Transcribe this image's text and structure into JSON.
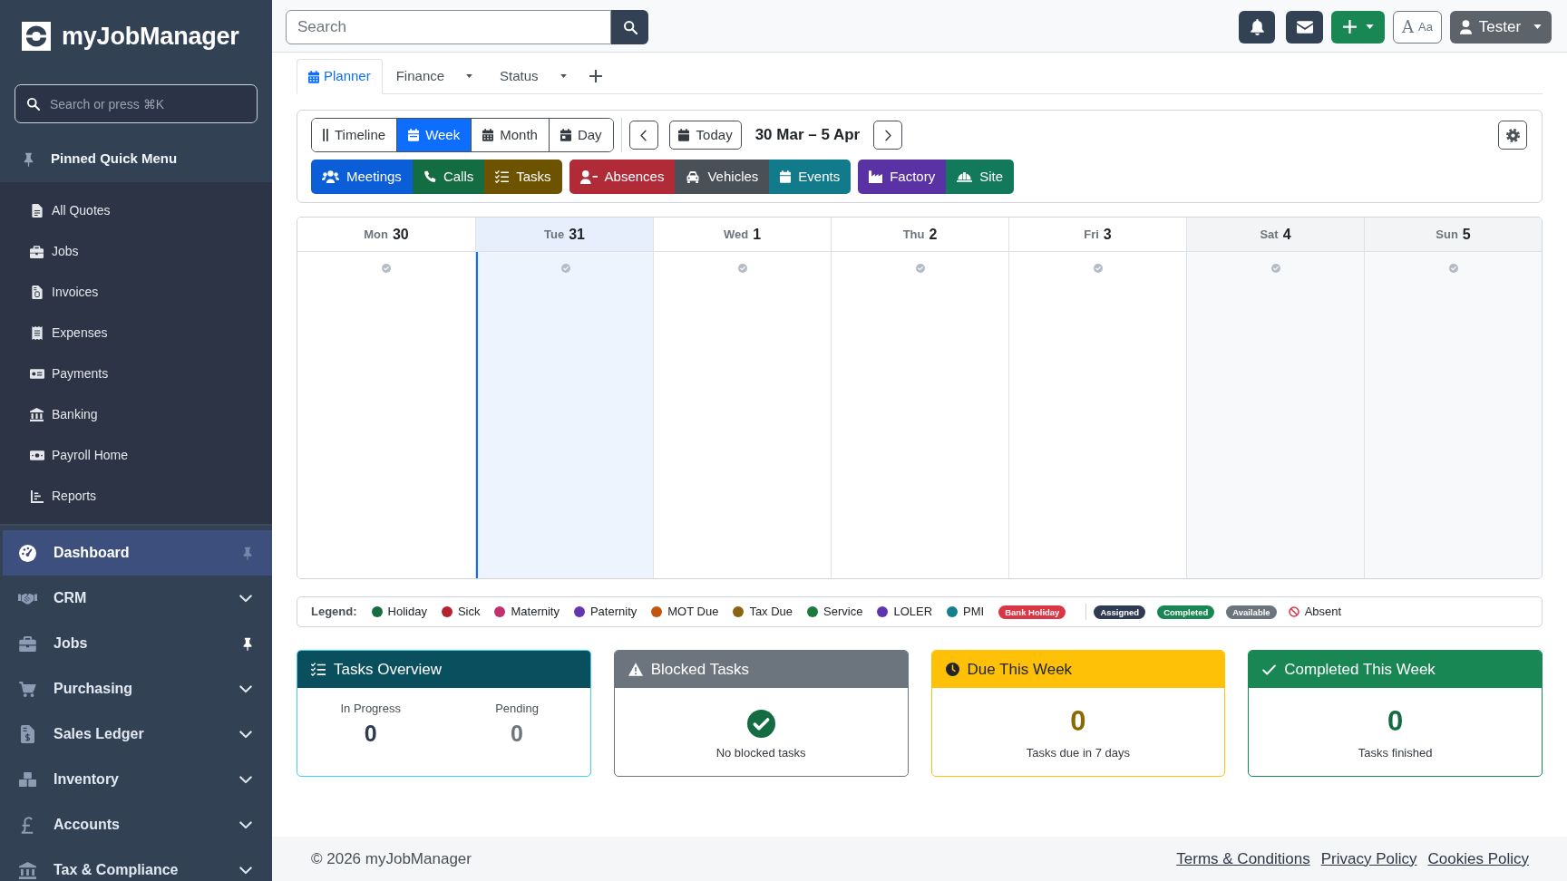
{
  "sidebar": {
    "brand": "myJobManager",
    "search": {
      "placeholder": "Search or press ⌘K"
    },
    "pinned_menu": {
      "title": "Pinned Quick Menu",
      "items": [
        "All Quotes",
        "Jobs",
        "Invoices",
        "Expenses",
        "Payments",
        "Banking",
        "Payroll Home",
        "Reports"
      ]
    },
    "nav": [
      {
        "label": "Dashboard",
        "kind": "link",
        "selected": true,
        "pinned": false
      },
      {
        "label": "CRM",
        "kind": "group",
        "selected": false,
        "expanded": false
      },
      {
        "label": "Jobs",
        "kind": "link",
        "selected": false,
        "pinned": true
      },
      {
        "label": "Purchasing",
        "kind": "group",
        "selected": false,
        "expanded": false
      },
      {
        "label": "Sales Ledger",
        "kind": "group",
        "selected": false,
        "expanded": false
      },
      {
        "label": "Inventory",
        "kind": "group",
        "selected": false,
        "expanded": false
      },
      {
        "label": "Accounts",
        "kind": "group",
        "selected": false,
        "expanded": false
      },
      {
        "label": "Tax & Compliance",
        "kind": "group",
        "selected": false,
        "expanded": false
      }
    ]
  },
  "topbar": {
    "search": {
      "placeholder": "Search"
    },
    "text_size_button": {
      "glyph": "A",
      "label": "Aa"
    },
    "user_menu": {
      "label": "Tester"
    }
  },
  "tabs": [
    {
      "label": "Planner",
      "selected": true,
      "has_menu": false
    },
    {
      "label": "Finance",
      "selected": false,
      "has_menu": true
    },
    {
      "label": "Status",
      "selected": false,
      "has_menu": true
    }
  ],
  "toolbar": {
    "view_modes": [
      {
        "label": "Timeline",
        "selected": false
      },
      {
        "label": "Week",
        "selected": true
      },
      {
        "label": "Month",
        "selected": false
      },
      {
        "label": "Day",
        "selected": false
      }
    ],
    "today_button": "Today",
    "date_range": "30 Mar – 5 Apr",
    "category_groups": [
      [
        {
          "label": "Meetings",
          "color": "#0b5ed7"
        },
        {
          "label": "Calls",
          "color": "#146c43"
        },
        {
          "label": "Tasks",
          "color": "#6d5200"
        }
      ],
      [
        {
          "label": "Absences",
          "color": "#b02a37"
        },
        {
          "label": "Vehicles",
          "color": "#495057"
        },
        {
          "label": "Events",
          "color": "#117a8b"
        }
      ],
      [
        {
          "label": "Factory",
          "color": "#5a32a3"
        },
        {
          "label": "Site",
          "color": "#13795b"
        }
      ]
    ]
  },
  "calendar": {
    "days": [
      {
        "weekday": "Mon",
        "date": "30",
        "today": false,
        "weekend": false
      },
      {
        "weekday": "Tue",
        "date": "31",
        "today": true,
        "weekend": false
      },
      {
        "weekday": "Wed",
        "date": "1",
        "today": false,
        "weekend": false
      },
      {
        "weekday": "Thu",
        "date": "2",
        "today": false,
        "weekend": false
      },
      {
        "weekday": "Fri",
        "date": "3",
        "today": false,
        "weekend": false
      },
      {
        "weekday": "Sat",
        "date": "4",
        "today": false,
        "weekend": true
      },
      {
        "weekday": "Sun",
        "date": "5",
        "today": false,
        "weekend": true
      }
    ]
  },
  "legend": {
    "title": "Legend:",
    "items": [
      {
        "kind": "dot",
        "label": "Holiday",
        "color": "#1a6b40"
      },
      {
        "kind": "dot",
        "label": "Sick",
        "color": "#b32430"
      },
      {
        "kind": "dot",
        "label": "Maternity",
        "color": "#c2306e"
      },
      {
        "kind": "dot",
        "label": "Paternity",
        "color": "#6236b0"
      },
      {
        "kind": "dot",
        "label": "MOT Due",
        "color": "#c2560f"
      },
      {
        "kind": "dot",
        "label": "Tax Due",
        "color": "#8a6212"
      },
      {
        "kind": "dot",
        "label": "Service",
        "color": "#1d7a3e"
      },
      {
        "kind": "dot",
        "label": "LOLER",
        "color": "#5e35b1"
      },
      {
        "kind": "dot",
        "label": "PMI",
        "color": "#157f8e"
      },
      {
        "kind": "badge",
        "label": "Bank Holiday",
        "color": "#dc3545"
      }
    ],
    "statuses": [
      {
        "kind": "badge",
        "label": "Assigned",
        "color": "#2f3b52"
      },
      {
        "kind": "badge",
        "label": "Completed",
        "color": "#198754"
      },
      {
        "kind": "badge",
        "label": "Available",
        "color": "#6c757d"
      },
      {
        "kind": "ban",
        "label": "Absent"
      }
    ]
  },
  "cards": [
    {
      "kind": "stats",
      "title": "Tasks Overview",
      "color": "#0a4f5e",
      "border": {
        "color": "#3cd3f0"
      },
      "stats": [
        {
          "label": "In Progress",
          "value": "0",
          "color": "#2d3a4f"
        },
        {
          "label": "Pending",
          "value": "0",
          "color": "#6c757d"
        }
      ]
    },
    {
      "kind": "empty",
      "title": "Blocked Tasks",
      "color": "#6c757d",
      "border": {
        "color": "#6c757d"
      },
      "message": "No blocked tasks"
    },
    {
      "kind": "count",
      "title": "Due This Week",
      "color": "#ffc107",
      "border": {
        "color": "#ffc107"
      },
      "stat": {
        "value": "0",
        "color": "#8a6a00"
      },
      "caption": "Tasks due in 7 days"
    },
    {
      "kind": "count",
      "title": "Completed This Week",
      "color": "#198754",
      "border": {
        "color": "#198754"
      },
      "stat": {
        "value": "0",
        "color": "#146c43"
      },
      "caption": "Tasks finished"
    }
  ],
  "footer": {
    "copyright": "© 2026 myJobManager",
    "links": [
      "Terms & Conditions",
      "Privacy Policy",
      "Cookies Policy"
    ]
  }
}
